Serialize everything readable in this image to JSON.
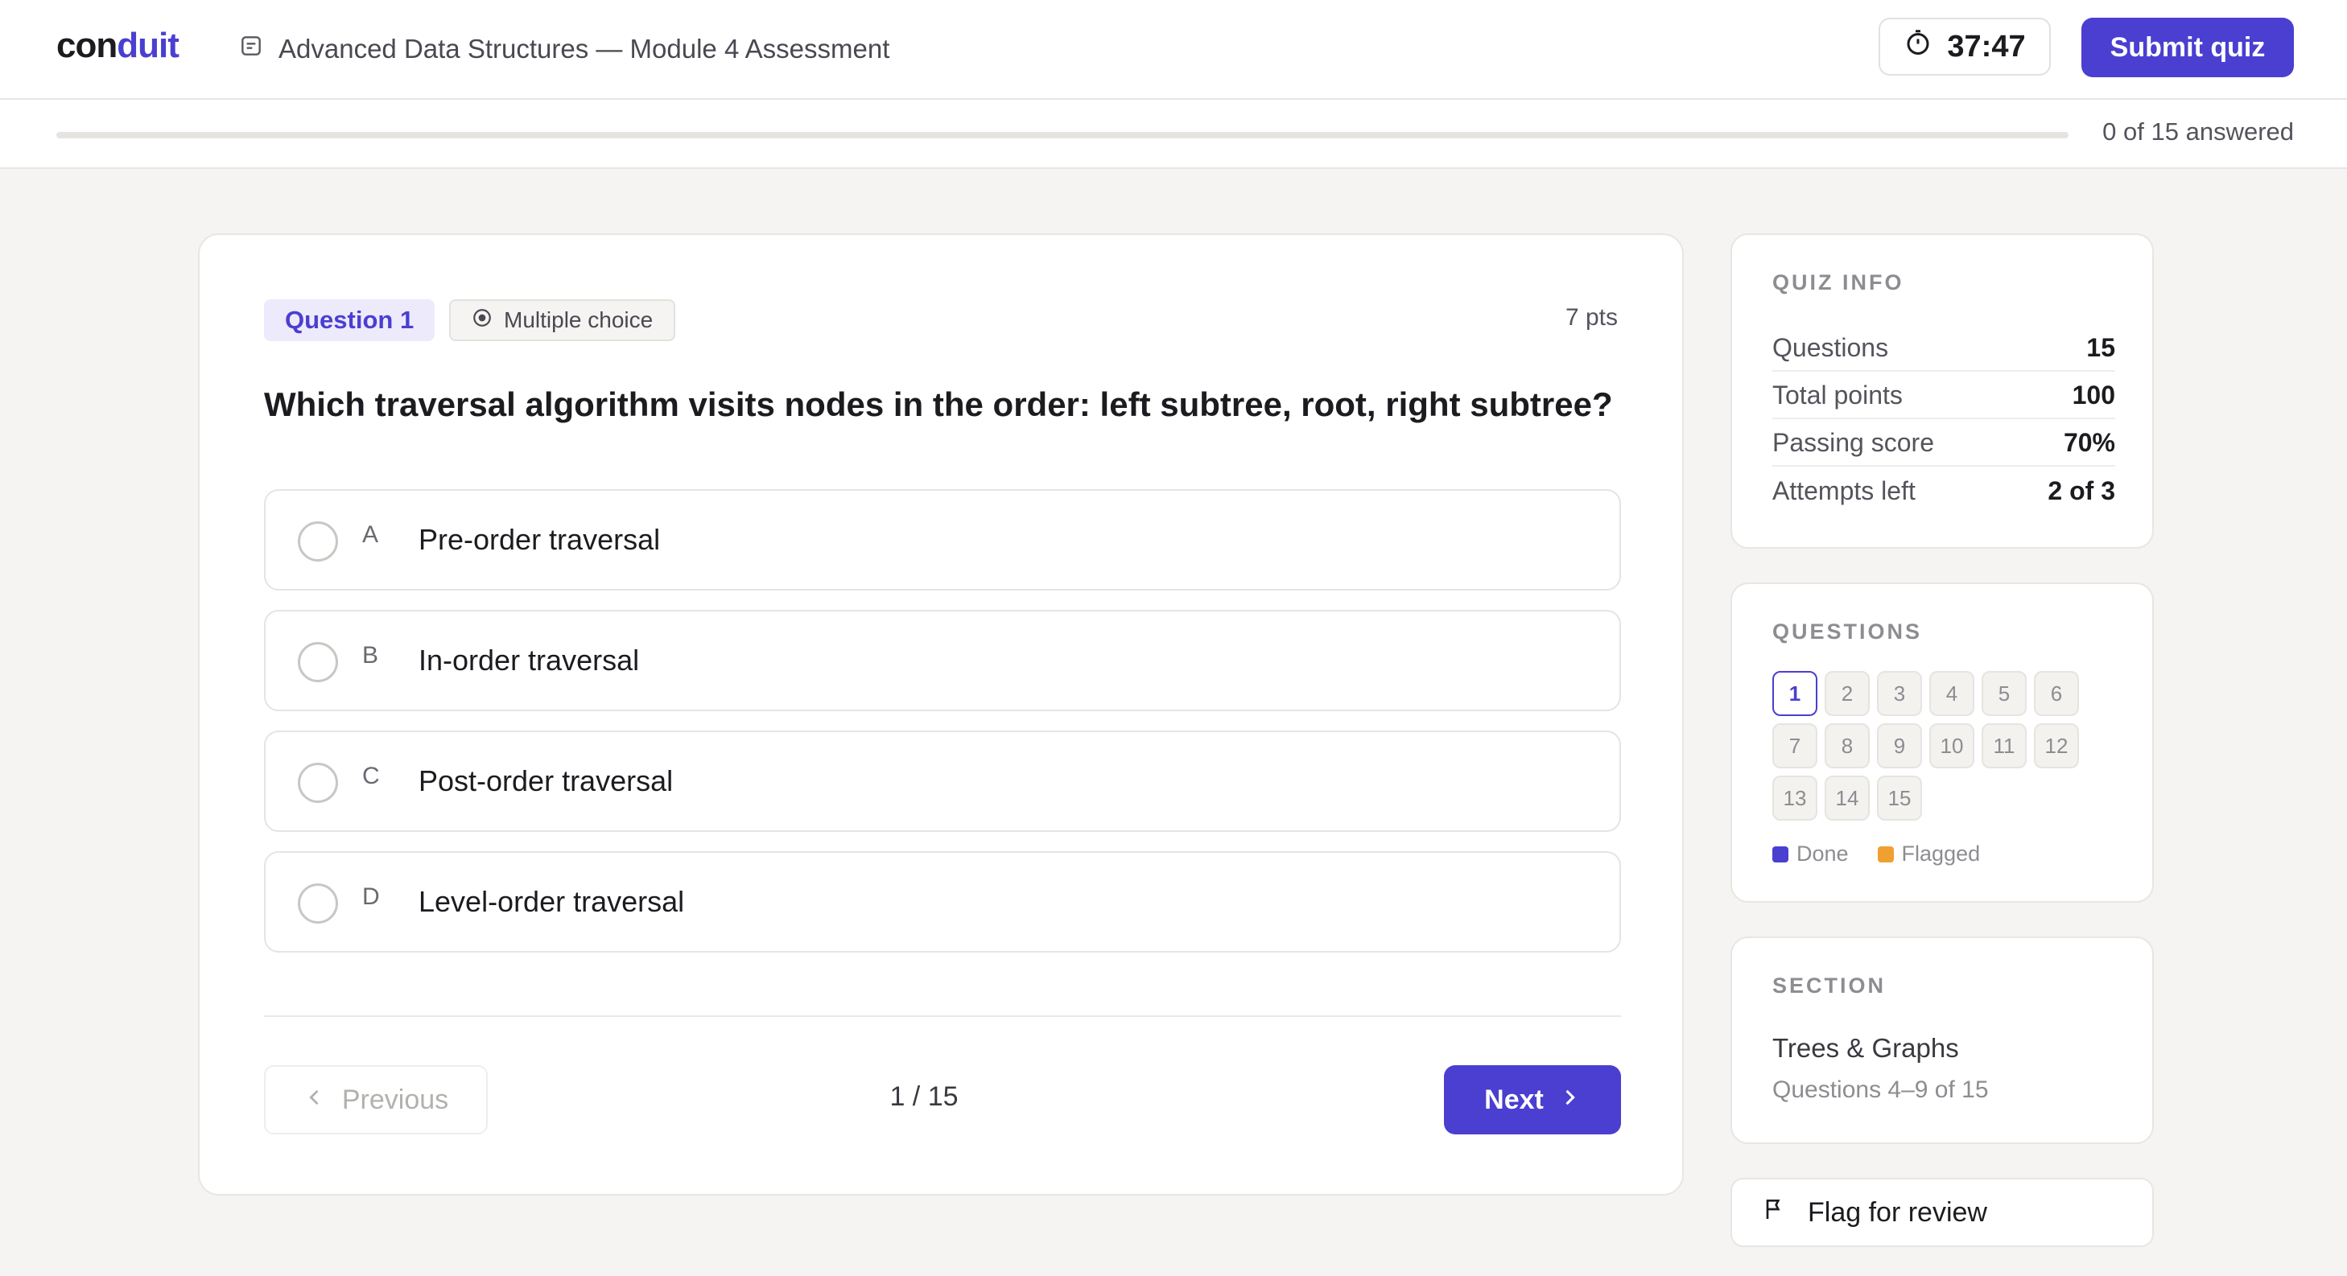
{
  "brand": {
    "name_part1": "con",
    "name_part2": "duit"
  },
  "header": {
    "doc_icon": "document-icon",
    "title": "Advanced Data Structures — Module 4 Assessment",
    "timer_icon": "stopwatch-icon",
    "timer": "37:47",
    "submit_label": "Submit quiz"
  },
  "progress": {
    "answered_fraction": 0,
    "label": "0 of 15 answered"
  },
  "question": {
    "tag": "Question 1",
    "type_icon": "radio-target-icon",
    "type": "Multiple choice",
    "points": "7 pts",
    "text": "Which traversal algorithm visits nodes in the order: left subtree, root, right subtree?",
    "options": [
      {
        "letter": "A",
        "label": "Pre-order traversal"
      },
      {
        "letter": "B",
        "label": "In-order traversal"
      },
      {
        "letter": "C",
        "label": "Post-order traversal"
      },
      {
        "letter": "D",
        "label": "Level-order traversal"
      }
    ]
  },
  "nav": {
    "previous_label": "Previous",
    "page_indicator": "1 / 15",
    "next_label": "Next"
  },
  "quiz_info": {
    "heading": "QUIZ INFO",
    "rows": [
      {
        "key": "Questions",
        "value": "15"
      },
      {
        "key": "Total points",
        "value": "100"
      },
      {
        "key": "Passing score",
        "value": "70%"
      },
      {
        "key": "Attempts left",
        "value": "2 of 3"
      }
    ]
  },
  "questions_panel": {
    "heading": "QUESTIONS",
    "numbers": [
      "1",
      "2",
      "3",
      "4",
      "5",
      "6",
      "7",
      "8",
      "9",
      "10",
      "11",
      "12",
      "13",
      "14",
      "15"
    ],
    "current": "1",
    "legend": {
      "done": "Done",
      "flagged": "Flagged"
    },
    "colors": {
      "done": "#4a3fd0",
      "flagged": "#f0a030"
    }
  },
  "section": {
    "heading": "SECTION",
    "name": "Trees & Graphs",
    "range": "Questions 4–9 of 15"
  },
  "flag": {
    "icon": "flag-icon",
    "label": "Flag for review"
  },
  "colors": {
    "accent": "#4a3fd0"
  }
}
